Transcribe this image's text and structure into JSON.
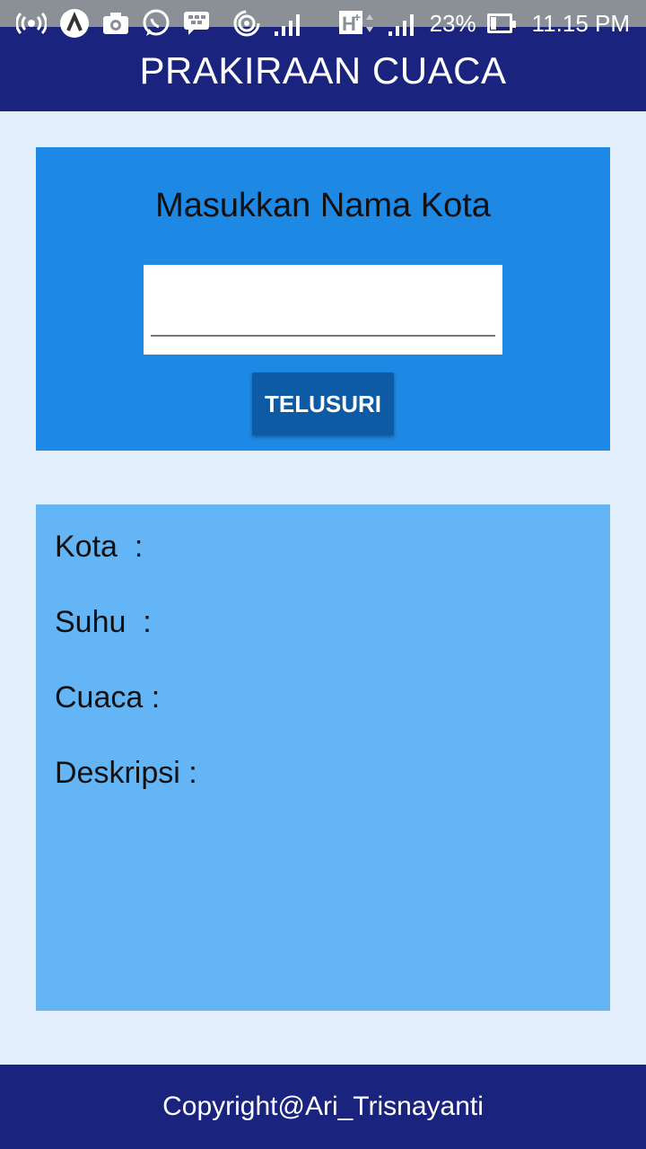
{
  "status_bar": {
    "battery": "23%",
    "time": "11.15 PM",
    "network": "H+",
    "icons": [
      "broadcast-icon",
      "app-a-icon",
      "camera-icon",
      "whatsapp-icon",
      "bbm-icon",
      "hotspot-icon",
      "signal-icon",
      "h-plus-icon",
      "signal-icon",
      "battery-icon"
    ]
  },
  "appbar": {
    "title": "PRAKIRAAN CUACA"
  },
  "search": {
    "heading": "Masukkan Nama Kota",
    "input_value": "",
    "button_label": "TELUSURI"
  },
  "result": {
    "city_label": "Kota  :",
    "temp_label": "Suhu  :",
    "weather_label": "Cuaca :",
    "desc_label": "Deskripsi :"
  },
  "footer": {
    "copyright": "Copyright@Ari_Trisnayanti"
  },
  "colors": {
    "primary_dark": "#1a237e",
    "search_card": "#1e88e5",
    "button": "#0d5aa5",
    "result_card": "#64b5f6",
    "background": "#e3f0fb"
  }
}
